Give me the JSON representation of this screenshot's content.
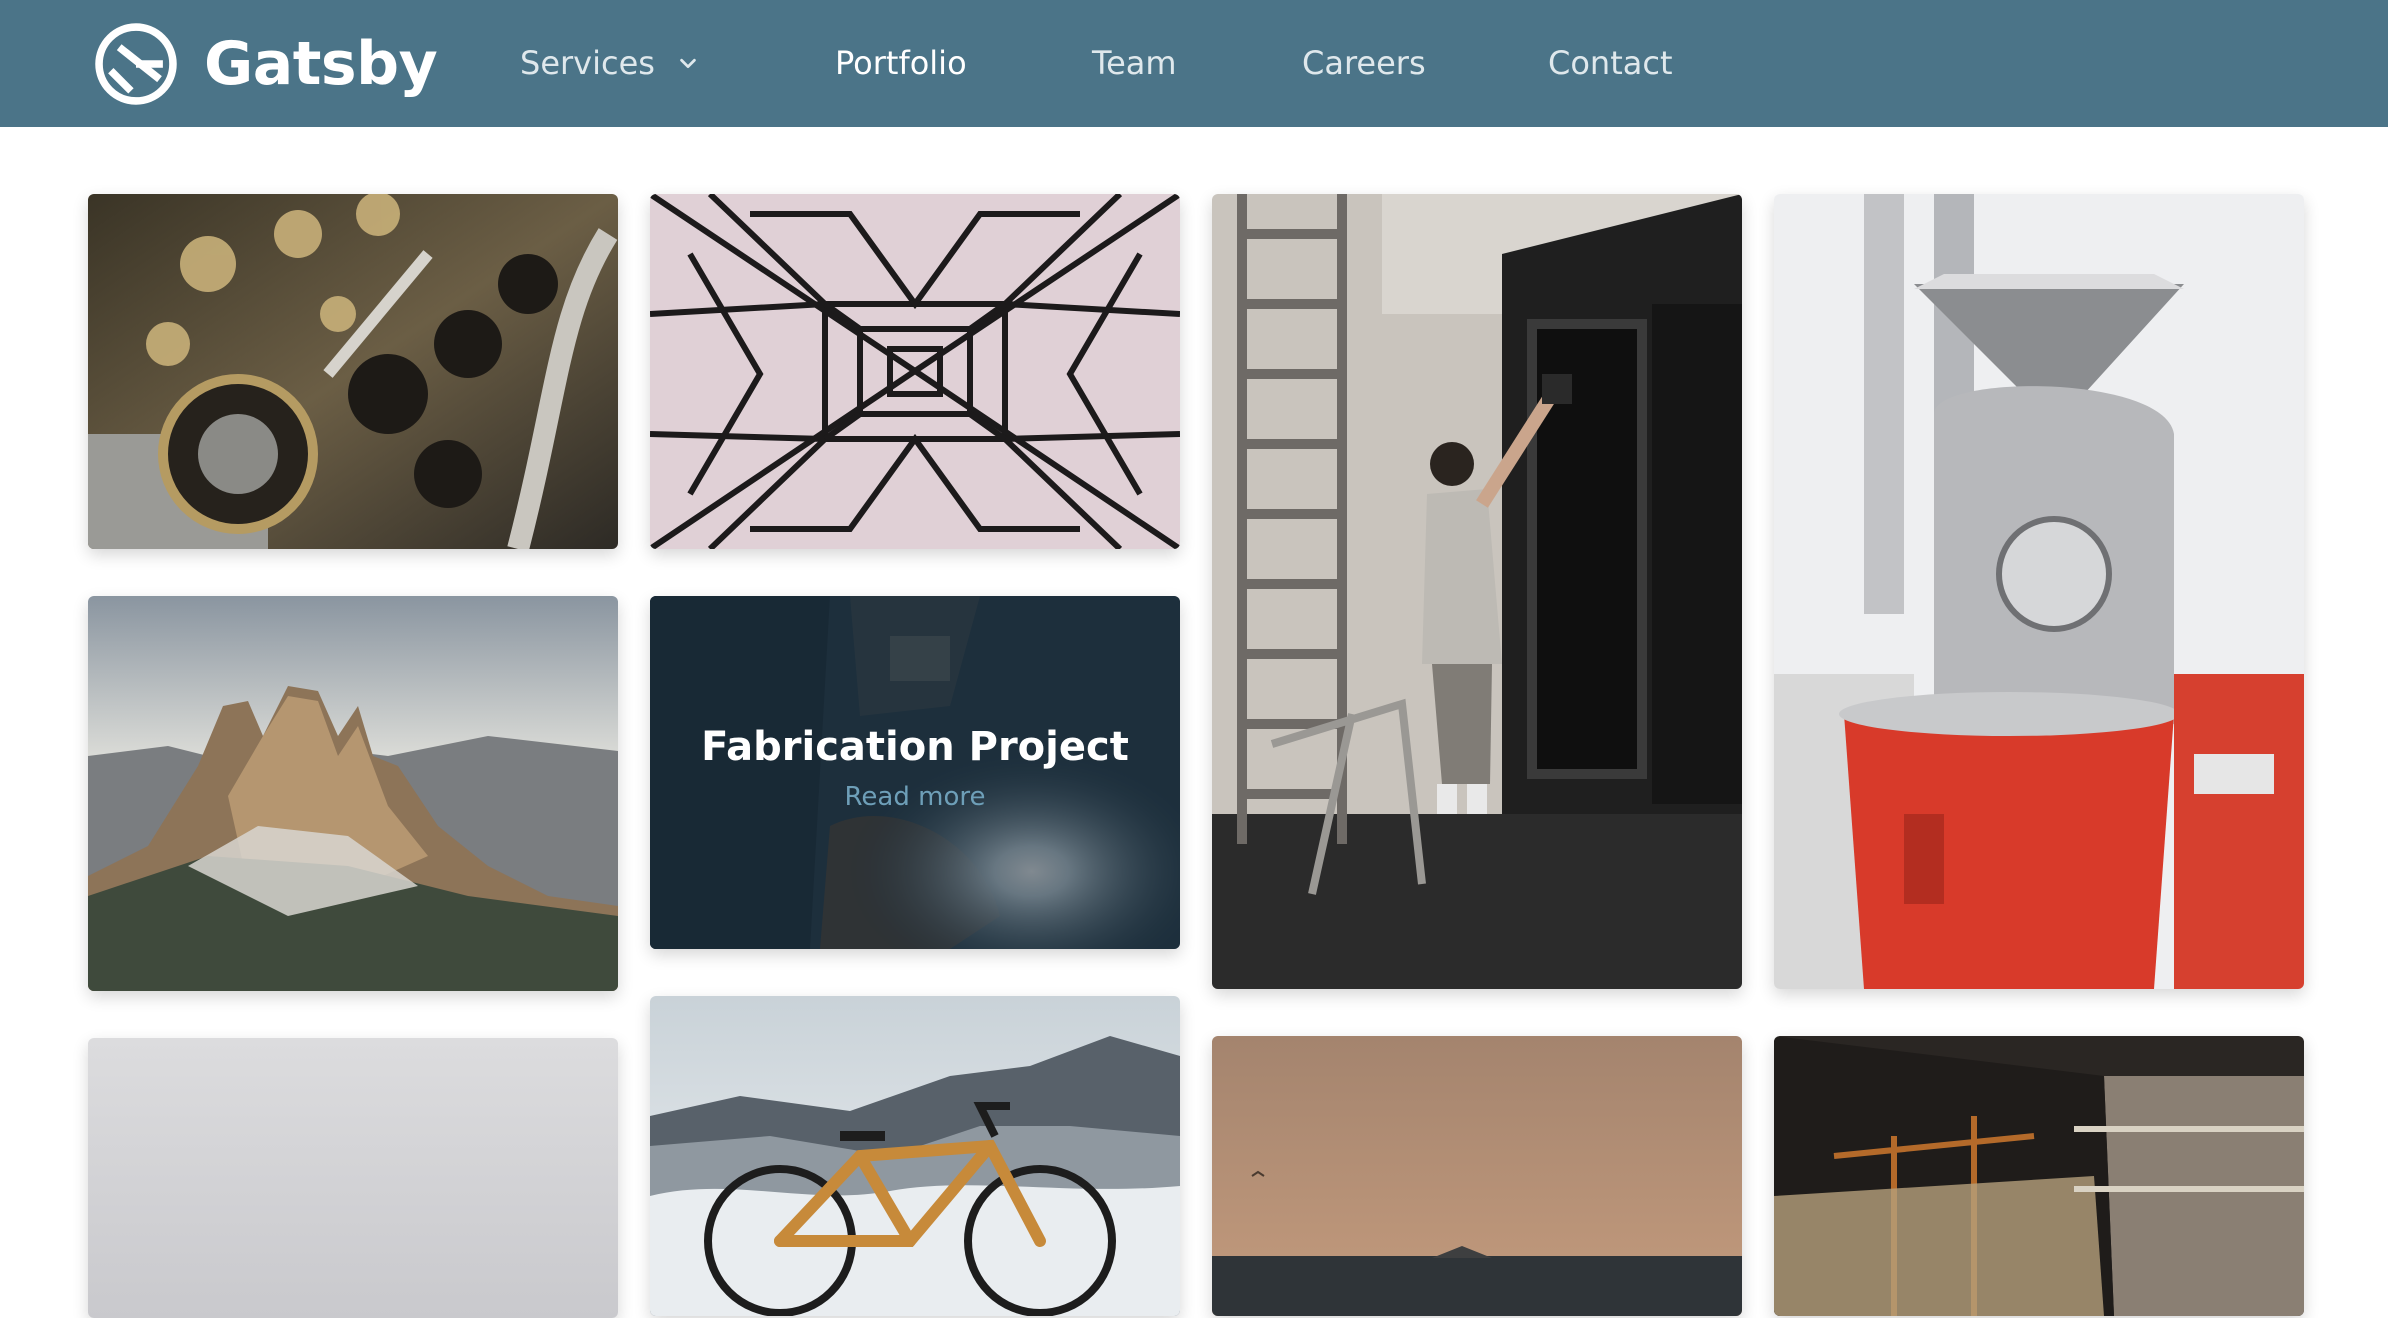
{
  "header": {
    "brand": "Gatsby",
    "nav": [
      {
        "label": "Services",
        "has_dropdown": true,
        "color": "#dfe8ec"
      },
      {
        "label": "Portfolio",
        "color": "#ffffff"
      },
      {
        "label": "Team",
        "color": "#dfe8ec"
      },
      {
        "label": "Careers",
        "color": "#dfe8ec"
      },
      {
        "label": "Contact",
        "color": "#dfe8ec"
      }
    ],
    "background": "#4b7488"
  },
  "portfolio": {
    "items": [
      {
        "image": "engine-camshaft-photo"
      },
      {
        "image": "power-pylon-photo"
      },
      {
        "image": "window-spray-painting-photo"
      },
      {
        "image": "coffee-roaster-photo"
      },
      {
        "image": "mountain-peaks-photo"
      },
      {
        "image": "welding-photo",
        "title": "Fabrication Project",
        "link": "Read more"
      },
      {
        "image": "foggy-sky-photo"
      },
      {
        "image": "bicycle-in-snow-photo"
      },
      {
        "image": "sunset-sea-photo"
      },
      {
        "image": "industrial-hall-photo"
      }
    ]
  }
}
